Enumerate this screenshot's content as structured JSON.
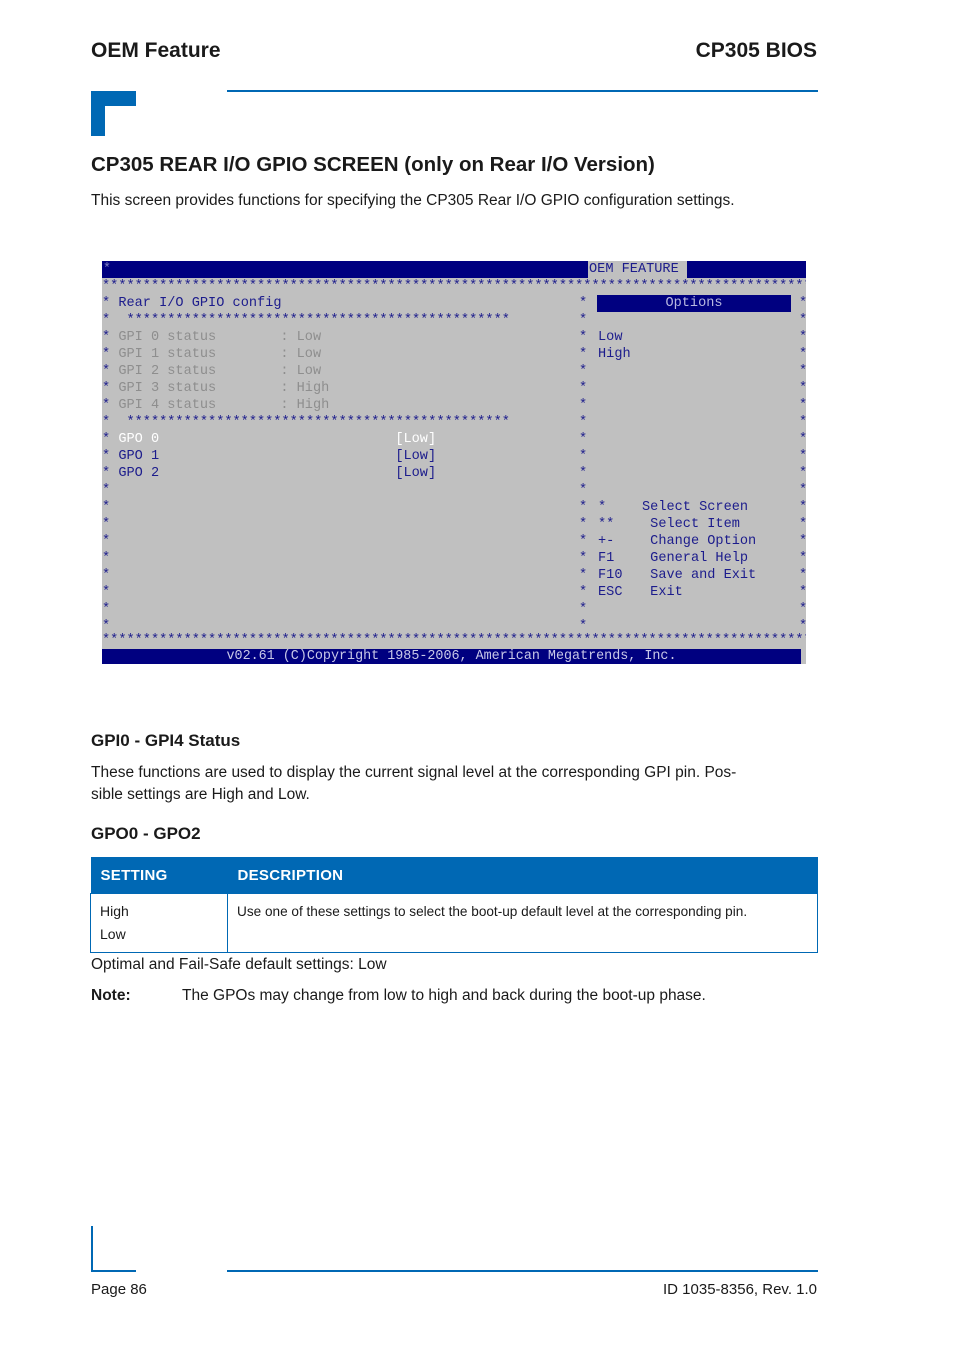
{
  "header": {
    "left_title": "OEM Feature",
    "right_title": "CP305 BIOS"
  },
  "section": {
    "title": "CP305 REAR I/O GPIO SCREEN (only on Rear I/O Version)",
    "intro": "This screen provides functions for specifying the CP305 Rear I/O GPIO configuration settings."
  },
  "bios": {
    "tab_label": "OEM FEATURE",
    "panel_title": "Rear I/O GPIO config",
    "gpi_items": [
      {
        "label": "GPI 0 status",
        "value": ": Low"
      },
      {
        "label": "GPI 1 status",
        "value": ": Low"
      },
      {
        "label": "GPI 2 status",
        "value": ": Low"
      },
      {
        "label": "GPI 3 status",
        "value": ": High"
      },
      {
        "label": "GPI 4 status",
        "value": ": High"
      }
    ],
    "gpo_items": [
      {
        "label": "GPO 0",
        "value": "[Low]",
        "selected": true
      },
      {
        "label": "GPO 1",
        "value": "[Low]",
        "selected": false
      },
      {
        "label": "GPO 2",
        "value": "[Low]",
        "selected": false
      }
    ],
    "options_title": "Options",
    "options": [
      "Low",
      "High"
    ],
    "help": [
      {
        "key": "*",
        "action": "Select Screen"
      },
      {
        "key": "**",
        "action": " Select Item"
      },
      {
        "key": "+-",
        "action": " Change Option"
      },
      {
        "key": "F1",
        "action": " General Help"
      },
      {
        "key": "F10",
        "action": " Save and Exit"
      },
      {
        "key": "ESC",
        "action": " Exit"
      }
    ],
    "copyright": "v02.61 (C)Copyright 1985-2006, American Megatrends, Inc."
  },
  "gpi_section": {
    "title": "GPI0 - GPI4 Status",
    "text_line1": "These functions are used to display the current signal level at the corresponding GPI pin. Pos-",
    "text_line2": "sible settings are High and Low."
  },
  "gpo_section": {
    "title": "GPO0 - GPO2",
    "table": {
      "headers": [
        "SETTING",
        "DESCRIPTION"
      ],
      "rows": [
        {
          "settings": [
            "High",
            "Low"
          ],
          "description": "Use one of these settings to select the boot-up default level at the corresponding pin."
        }
      ]
    },
    "defaults": "Optimal and Fail-Safe default settings: Low",
    "note_label": "Note:",
    "note_text": "The GPOs may change from low to high and back during the boot-up phase."
  },
  "footer": {
    "page": "Page 86",
    "doc_id": "ID 1035-8356, Rev. 1.0"
  },
  "colors": {
    "accent": "#0068b4",
    "bios_blue": "#000080",
    "bios_gray": "#c0c0c0"
  }
}
